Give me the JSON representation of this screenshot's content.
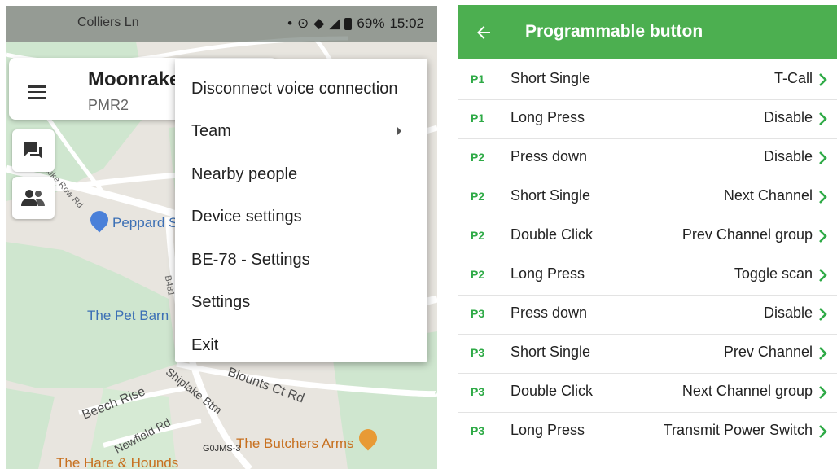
{
  "left": {
    "status_bar": {
      "street_label": "Colliers Ln",
      "battery": "69%",
      "time": "15:02",
      "icons": [
        "sim-icon",
        "gmail-icon",
        "dot-icon",
        "location-icon",
        "wifi-icon",
        "signal-icon",
        "battery-icon"
      ]
    },
    "header": {
      "menu_icon": "hamburger-icon",
      "title": "Moonrake",
      "subtitle": "PMR2"
    },
    "side_buttons": [
      "chat-icon",
      "people-icon"
    ],
    "map_labels": {
      "peppard_top": "Peppard",
      "stoke_row_rd": "Stoke Row Rd",
      "peppard_s": "Peppard S",
      "b481": "B481",
      "pet_barn": "The Pet Barn",
      "shiplake_btm": "Shiplake Btm",
      "blounts_ct_rd": "Blounts Ct Rd",
      "beech_rise": "Beech Rise",
      "newfield_rd": "Newfield Rd",
      "butchers_arms": "The Butchers Arms",
      "g0jms3": "G0JMS-3",
      "hare_hounds": "The Hare & Hounds"
    },
    "menu": {
      "items": [
        "Disconnect voice connection",
        "Team",
        "Nearby people",
        "Device settings",
        "BE-78 - Settings",
        "Settings",
        "Exit"
      ],
      "submenu_icon": "caret-right-icon"
    }
  },
  "right": {
    "app_bar": {
      "back_icon": "arrow-left-icon",
      "title": "Programmable button",
      "color": "#4caf50"
    },
    "accent_color": "#2eaa46",
    "rows": [
      {
        "id": "P1",
        "press": "Short Single",
        "function": "T-Call"
      },
      {
        "id": "P1",
        "press": "Long Press",
        "function": "Disable"
      },
      {
        "id": "P2",
        "press": "Press down",
        "function": "Disable"
      },
      {
        "id": "P2",
        "press": "Short Single",
        "function": "Next Channel"
      },
      {
        "id": "P2",
        "press": "Double Click",
        "function": "Prev Channel group"
      },
      {
        "id": "P2",
        "press": "Long Press",
        "function": "Toggle scan"
      },
      {
        "id": "P3",
        "press": "Press down",
        "function": "Disable"
      },
      {
        "id": "P3",
        "press": "Short Single",
        "function": "Prev Channel"
      },
      {
        "id": "P3",
        "press": "Double Click",
        "function": "Next Channel group"
      },
      {
        "id": "P3",
        "press": "Long Press",
        "function": "Transmit Power Switch"
      }
    ]
  }
}
